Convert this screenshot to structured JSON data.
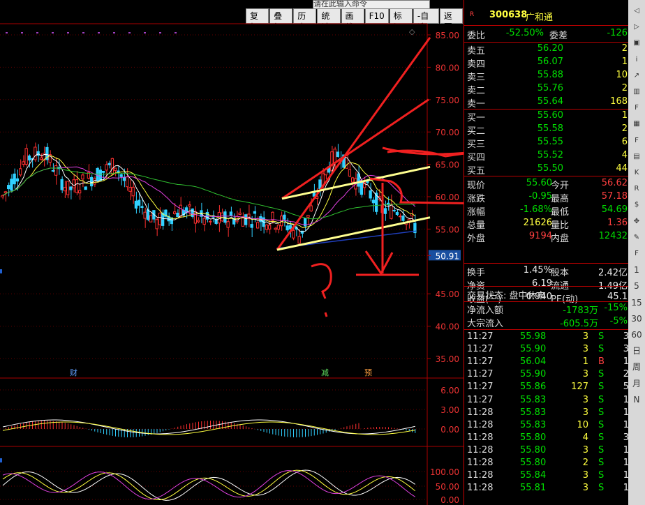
{
  "command_input": "请在此输入命令",
  "toolbar": [
    "复权",
    "叠加",
    "历史",
    "统计",
    "画线",
    "F10",
    "标记",
    "-自选",
    "返回"
  ],
  "yaxis": [
    "85.00",
    "80.00",
    "75.00",
    "70.00",
    "65.00",
    "60.00",
    "55.00",
    "50.91",
    "45.00",
    "40.00",
    "35.00"
  ],
  "macd_axis": [
    "6.00",
    "3.00",
    "0.00"
  ],
  "kdj_axis": [
    "100.00",
    "50.00",
    "0.00"
  ],
  "chart_flags": {
    "cai": "财",
    "jian": "减",
    "yu": "预"
  },
  "stock": {
    "flag": "R",
    "code": "300638",
    "name": "广和通"
  },
  "weibi": {
    "label1": "委比",
    "val1": "-52.50%",
    "label2": "委差",
    "val2": "-126"
  },
  "asks": [
    {
      "label": "卖五",
      "price": "56.20",
      "vol": "2"
    },
    {
      "label": "卖四",
      "price": "56.07",
      "vol": "1"
    },
    {
      "label": "卖三",
      "price": "55.88",
      "vol": "10"
    },
    {
      "label": "卖二",
      "price": "55.76",
      "vol": "2"
    },
    {
      "label": "卖一",
      "price": "55.64",
      "vol": "168"
    }
  ],
  "bids": [
    {
      "label": "买一",
      "price": "55.60",
      "vol": "1"
    },
    {
      "label": "买二",
      "price": "55.58",
      "vol": "2"
    },
    {
      "label": "买三",
      "price": "55.55",
      "vol": "6"
    },
    {
      "label": "买四",
      "price": "55.52",
      "vol": "4"
    },
    {
      "label": "买五",
      "price": "55.50",
      "vol": "44"
    }
  ],
  "quote": [
    {
      "l1": "现价",
      "v1": "55.60",
      "l2": "今开",
      "v2": "56.62",
      "c1": "green",
      "c2": "red"
    },
    {
      "l1": "涨跌",
      "v1": "-0.95",
      "l2": "最高",
      "v2": "57.18",
      "c1": "green",
      "c2": "red"
    },
    {
      "l1": "涨幅",
      "v1": "-1.68%",
      "l2": "最低",
      "v2": "54.69",
      "c1": "green",
      "c2": "green"
    },
    {
      "l1": "总量",
      "v1": "21626",
      "l2": "量比",
      "v2": "1.36",
      "c1": "yellow",
      "c2": "red"
    },
    {
      "l1": "外盘",
      "v1": "9194",
      "l2": "内盘",
      "v2": "12432",
      "c1": "red",
      "c2": "green"
    }
  ],
  "fund": [
    {
      "l1": "换手",
      "v1": "1.45%",
      "l2": "股本",
      "v2": "2.42亿"
    },
    {
      "l1": "净资",
      "v1": "6.19",
      "l2": "流通",
      "v2": "1.49亿"
    },
    {
      "l1": "收益(三)",
      "v1": "0.940",
      "l2": "PE(动)",
      "v2": "45.1"
    }
  ],
  "trade_status": "交易状态: 盘中休市",
  "flows": [
    {
      "label": "净流入额",
      "val": "-1783万",
      "pct": "-15%"
    },
    {
      "label": "大宗流入",
      "val": "-605.5万",
      "pct": "-5%"
    }
  ],
  "ticks": [
    {
      "t": "11:27",
      "p": "55.98",
      "v": "3",
      "bs": "S",
      "n": "3"
    },
    {
      "t": "11:27",
      "p": "55.90",
      "v": "3",
      "bs": "S",
      "n": "3"
    },
    {
      "t": "11:27",
      "p": "56.04",
      "v": "1",
      "bs": "B",
      "n": "1"
    },
    {
      "t": "11:27",
      "p": "55.90",
      "v": "3",
      "bs": "S",
      "n": "2"
    },
    {
      "t": "11:27",
      "p": "55.86",
      "v": "127",
      "bs": "S",
      "n": "5"
    },
    {
      "t": "11:27",
      "p": "55.83",
      "v": "3",
      "bs": "S",
      "n": "1"
    },
    {
      "t": "11:28",
      "p": "55.83",
      "v": "3",
      "bs": "S",
      "n": "1"
    },
    {
      "t": "11:28",
      "p": "55.83",
      "v": "10",
      "bs": "S",
      "n": "1"
    },
    {
      "t": "11:28",
      "p": "55.80",
      "v": "4",
      "bs": "S",
      "n": "3"
    },
    {
      "t": "11:28",
      "p": "55.80",
      "v": "3",
      "bs": "S",
      "n": "1"
    },
    {
      "t": "11:28",
      "p": "55.80",
      "v": "2",
      "bs": "S",
      "n": "1"
    },
    {
      "t": "11:28",
      "p": "55.84",
      "v": "3",
      "bs": "S",
      "n": "1"
    },
    {
      "t": "11:28",
      "p": "55.81",
      "v": "3",
      "bs": "S",
      "n": "1"
    }
  ],
  "side_icons": [
    "arrow-left-icon",
    "arrow-right-icon",
    "window-icon",
    "info-icon",
    "chart-icon",
    "candle-icon",
    "f10-icon",
    "grid-icon",
    "f12-icon",
    "table-icon",
    "k-icon",
    "rsi-icon",
    "dollar-icon",
    "move-icon",
    "pen-icon",
    "f5-icon",
    "timeframe-1",
    "timeframe-5",
    "timeframe-15",
    "timeframe-30",
    "timeframe-60",
    "day-icon",
    "week-icon",
    "month-icon"
  ],
  "side_labels": [
    "1",
    "5",
    "15",
    "30",
    "60",
    "日",
    "周",
    "月",
    "N"
  ]
}
